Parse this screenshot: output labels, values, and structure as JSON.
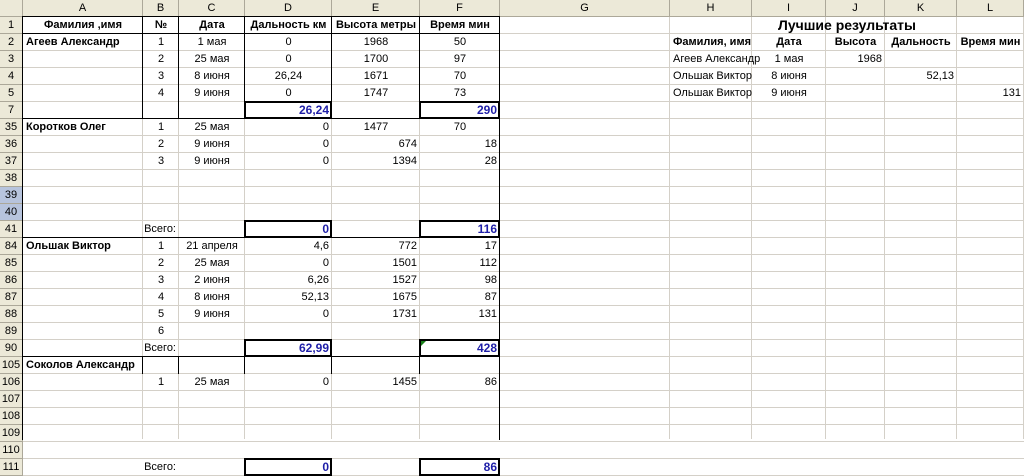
{
  "columns": [
    "A",
    "B",
    "C",
    "D",
    "E",
    "F",
    "G",
    "H",
    "I",
    "J",
    "K",
    "L"
  ],
  "rows": [
    "1",
    "2",
    "3",
    "4",
    "5",
    "7",
    "35",
    "36",
    "37",
    "38",
    "39",
    "40",
    "41",
    "84",
    "85",
    "86",
    "87",
    "88",
    "89",
    "90",
    "105",
    "106",
    "107",
    "108",
    "109",
    "110",
    "111"
  ],
  "headers": {
    "name": "Фамилия ,имя",
    "num": "№",
    "date": "Дата",
    "distance": "Дальность км",
    "height": "Высота метры",
    "time": "Время мин"
  },
  "persons": [
    {
      "name": "Агеев Александр",
      "entries": [
        {
          "n": "1",
          "date": "1 мая",
          "dist": "0",
          "height": "1968",
          "time": "50"
        },
        {
          "n": "2",
          "date": "25 мая",
          "dist": "0",
          "height": "1700",
          "time": "97"
        },
        {
          "n": "3",
          "date": "8 июня",
          "dist": "26,24",
          "height": "1671",
          "time": "70"
        },
        {
          "n": "4",
          "date": "9 июня",
          "dist": "0",
          "height": "1747",
          "time": "73"
        }
      ],
      "total_label": "",
      "total_dist": "26,24",
      "total_time": "290"
    },
    {
      "name": "Коротков Олег",
      "entries": [
        {
          "n": "1",
          "date": "25 мая",
          "dist": "0",
          "height": "1477",
          "time": "70"
        },
        {
          "n": "2",
          "date": "9 июня",
          "dist": "0",
          "height": "674",
          "time": "18"
        },
        {
          "n": "3",
          "date": "9 июня",
          "dist": "0",
          "height": "1394",
          "time": "28"
        }
      ],
      "total_label": "Всего:",
      "total_dist": "0",
      "total_time": "116"
    },
    {
      "name": "Ольшак Виктор",
      "entries": [
        {
          "n": "1",
          "date": "21 апреля",
          "dist": "4,6",
          "height": "772",
          "time": "17"
        },
        {
          "n": "2",
          "date": "25 мая",
          "dist": "0",
          "height": "1501",
          "time": "112"
        },
        {
          "n": "3",
          "date": "2 июня",
          "dist": "6,26",
          "height": "1527",
          "time": "98"
        },
        {
          "n": "4",
          "date": "8 июня",
          "dist": "52,13",
          "height": "1675",
          "time": "87"
        },
        {
          "n": "5",
          "date": "9 июня",
          "dist": "0",
          "height": "1731",
          "time": "131"
        },
        {
          "n": "6",
          "date": "",
          "dist": "",
          "height": "",
          "time": ""
        }
      ],
      "total_label": "Всего:",
      "total_dist": "62,99",
      "total_time": "428"
    },
    {
      "name": "Соколов Александр",
      "entries": [
        {
          "n": "1",
          "date": "25 мая",
          "dist": "0",
          "height": "1455",
          "time": "86"
        }
      ],
      "total_label": "Всего:",
      "total_dist": "0",
      "total_time": "86"
    }
  ],
  "best": {
    "title": "Лучшие результаты",
    "headers": [
      "Фамилия, имя",
      "Дата",
      "Высота",
      "Дальность",
      "Время мин"
    ],
    "rows": [
      {
        "name": "Агеев Александр",
        "date": "1 мая",
        "height": "1968",
        "dist": "",
        "time": ""
      },
      {
        "name": "Ольшак Виктор",
        "date": "8 июня",
        "height": "",
        "dist": "52,13",
        "time": ""
      },
      {
        "name": "Ольшак Виктор",
        "date": "9 июня",
        "height": "",
        "dist": "",
        "time": "131"
      }
    ]
  },
  "colors": {
    "header_bg": "#ece9d8",
    "header_selected": "#b7c4dd",
    "total_text": "#1f1fa8",
    "gridline": "#d4d0c8"
  }
}
